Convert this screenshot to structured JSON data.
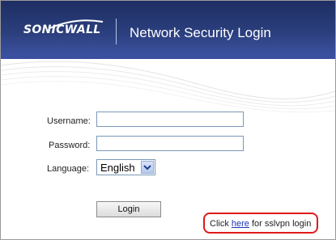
{
  "header": {
    "logo_text": "SONICWALL",
    "title": "Network Security Login"
  },
  "form": {
    "username_label": "Username:",
    "username_value": "",
    "password_label": "Password:",
    "password_value": "",
    "language_label": "Language:",
    "language_selected": "English",
    "login_button": "Login"
  },
  "sslvpn": {
    "prefix": "Click ",
    "link": "here",
    "suffix": " for sslvpn login"
  },
  "colors": {
    "header_bg": "#2b3f7e",
    "highlight_border": "#e01a1a",
    "link": "#1a34b8"
  }
}
